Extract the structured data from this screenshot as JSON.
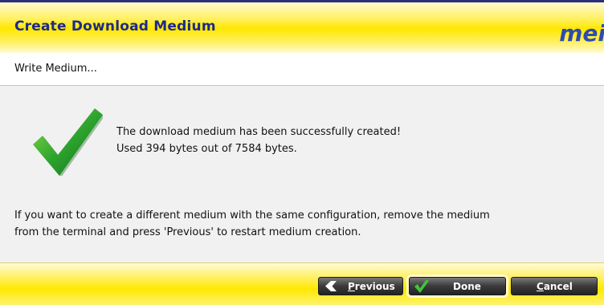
{
  "header": {
    "title": "Create Download Medium",
    "logo_text": "mei"
  },
  "subheader": {
    "step": "Write Medium..."
  },
  "content": {
    "status_icon": "checkmark-icon",
    "success_line1": "The download medium has been successfully created!",
    "success_line2": "Used 394 bytes out of 7584 bytes.",
    "info_line1": "If you want to create a different medium with the same configuration, remove the medium",
    "info_line2": "from the terminal and press 'Previous' to restart medium creation."
  },
  "footer": {
    "previous_label": "Previous",
    "done_label": "Done",
    "cancel_label": "Cancel"
  },
  "colors": {
    "title": "#1d2a8a",
    "header_yellow": "#ffe800",
    "check_green": "#2ea52e",
    "button_dark": "#2b2b2b"
  }
}
